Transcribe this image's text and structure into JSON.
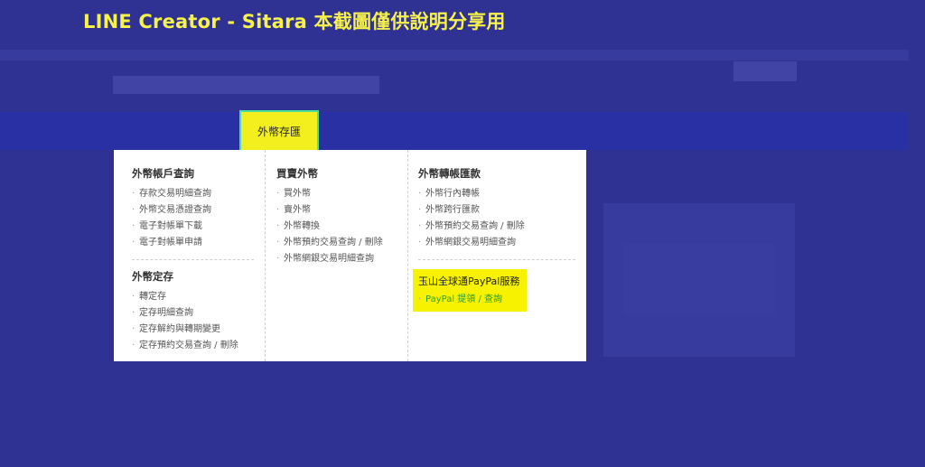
{
  "watermark": "LINE Creator - Sitara 本截圖僅供說明分享用",
  "nav": {
    "active_tab": "外幣存匯"
  },
  "menu": {
    "col1": {
      "sections": [
        {
          "title": "外幣帳戶查詢",
          "items": [
            "存款交易明細查詢",
            "外幣交易憑證查詢",
            "電子對帳單下載",
            "電子對帳單申請"
          ]
        },
        {
          "title": "外幣定存",
          "items": [
            "轉定存",
            "定存明細查詢",
            "定存解約與轉期變更",
            "定存預約交易查詢 / 刪除"
          ]
        }
      ]
    },
    "col2": {
      "sections": [
        {
          "title": "買賣外幣",
          "items": [
            "買外幣",
            "賣外幣",
            "外幣轉換",
            "外幣預約交易查詢 / 刪除",
            "外幣網銀交易明細查詢"
          ]
        }
      ]
    },
    "col3": {
      "sections": [
        {
          "title": "外幣轉帳匯款",
          "items": [
            "外幣行內轉帳",
            "外幣跨行匯款",
            "外幣預約交易查詢 / 刪除",
            "外幣網銀交易明細查詢"
          ]
        }
      ],
      "highlight": {
        "title": "玉山全球通PayPal服務",
        "items": [
          "PayPal 提領 / 查詢"
        ]
      }
    }
  },
  "colors": {
    "background": "#2f3193",
    "highlight": "#f6f200",
    "watermark": "#f7f24a",
    "link_green": "#2f9e2f"
  }
}
